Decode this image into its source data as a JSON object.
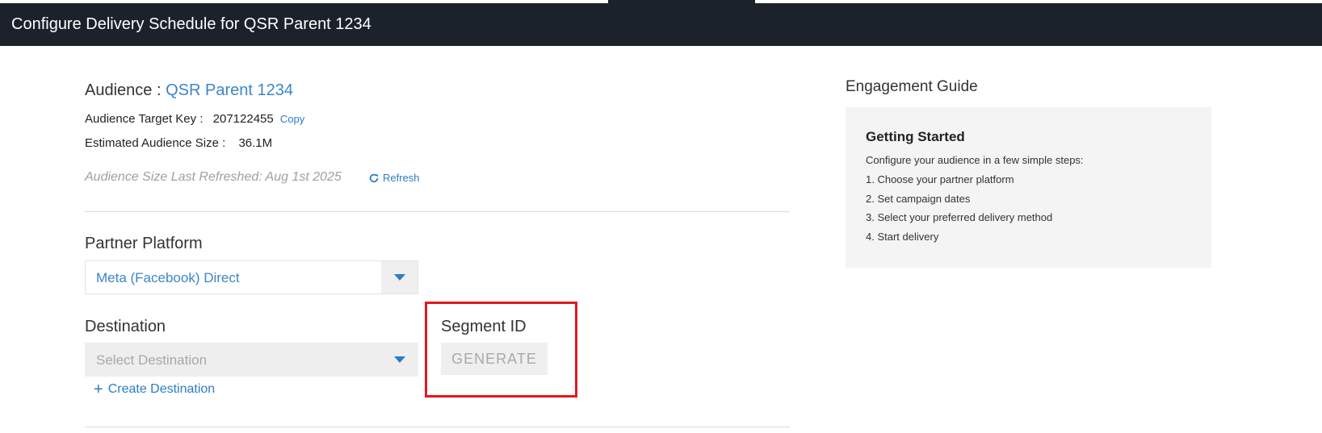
{
  "header": {
    "title": "Configure Delivery Schedule for QSR Parent 1234"
  },
  "audience": {
    "label": "Audience :",
    "name": "QSR Parent 1234",
    "target_key_label": "Audience Target Key :",
    "target_key_value": "207122455",
    "copy_label": "Copy",
    "size_label": "Estimated Audience Size :",
    "size_value": "36.1M",
    "last_refreshed": "Audience Size Last Refreshed: Aug 1st 2025",
    "refresh_label": "Refresh"
  },
  "partner_platform": {
    "label": "Partner Platform",
    "selected": "Meta (Facebook) Direct"
  },
  "destination": {
    "label": "Destination",
    "placeholder": "Select Destination",
    "create_label": "Create Destination"
  },
  "segment": {
    "label": "Segment ID",
    "generate_label": "GENERATE"
  },
  "guide": {
    "title": "Engagement Guide",
    "heading": "Getting Started",
    "intro": "Configure your audience in a few simple steps:",
    "steps": [
      "1. Choose your partner platform",
      "2. Set campaign dates",
      "3. Select your preferred delivery method",
      "4. Start delivery"
    ]
  },
  "colors": {
    "header_bg": "#1b222b",
    "link": "#2c7cc4",
    "highlight": "#e0191e"
  }
}
